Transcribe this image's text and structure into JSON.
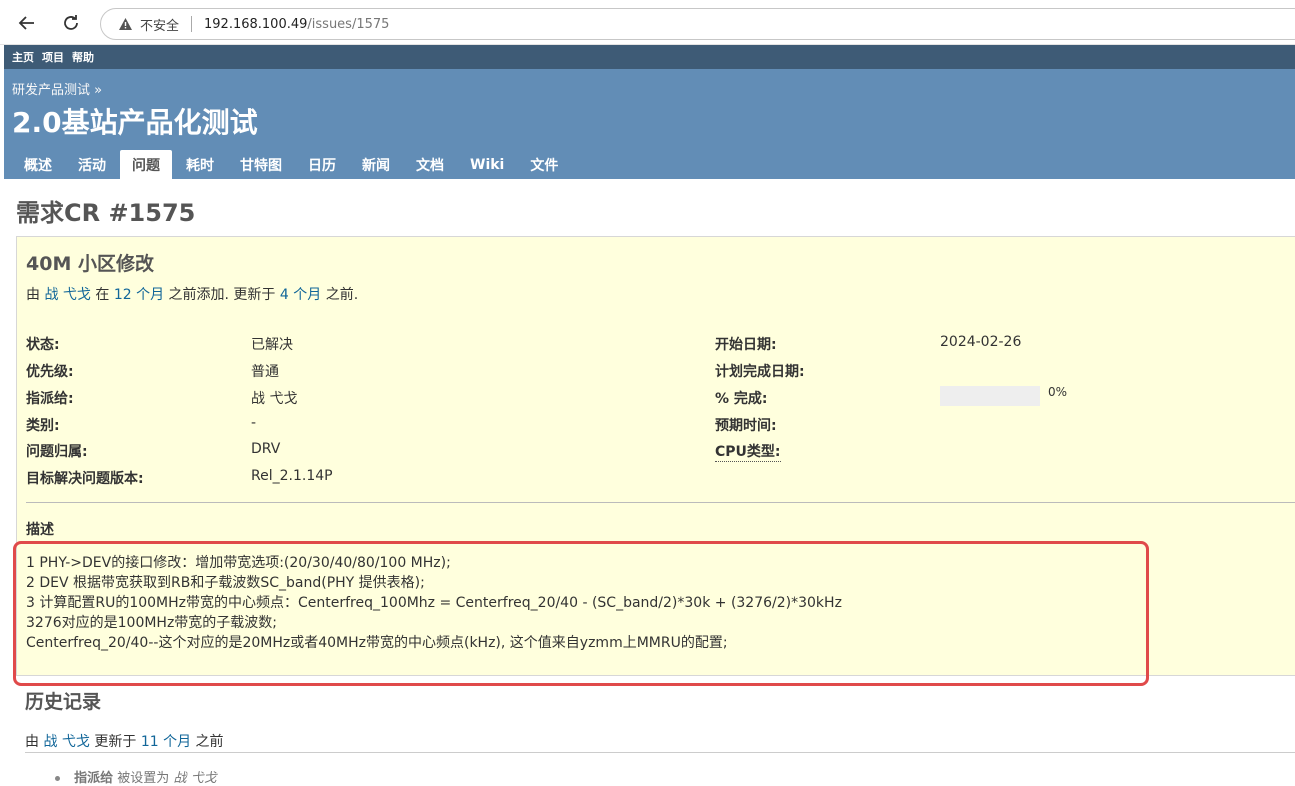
{
  "browser": {
    "insecure_label": "不安全",
    "url_host": "192.168.100.49",
    "url_path": "/issues/1575"
  },
  "top_menu": [
    "主页",
    "项目",
    "帮助"
  ],
  "header": {
    "parent_project": "研发产品测试 »",
    "project_title": "2.0基站产品化测试"
  },
  "tabs": [
    {
      "label": "概述",
      "selected": false
    },
    {
      "label": "活动",
      "selected": false
    },
    {
      "label": "问题",
      "selected": true
    },
    {
      "label": "耗时",
      "selected": false
    },
    {
      "label": "甘特图",
      "selected": false
    },
    {
      "label": "日历",
      "selected": false
    },
    {
      "label": "新闻",
      "selected": false
    },
    {
      "label": "文档",
      "selected": false
    },
    {
      "label": "Wiki",
      "selected": false
    },
    {
      "label": "文件",
      "selected": false
    }
  ],
  "issue": {
    "heading": "需求CR #1575",
    "subject": "40M 小区修改",
    "author_prefix": "由",
    "author": "战 弋戈",
    "added_prefix": "在",
    "added_ago": "12 个月",
    "added_suffix": "之前添加. 更新于",
    "updated_ago": "4 个月",
    "updated_suffix": "之前.",
    "attributes_left": [
      {
        "label": "状态:",
        "value": "已解决",
        "link": false
      },
      {
        "label": "优先级:",
        "value": "普通",
        "link": false
      },
      {
        "label": "指派给:",
        "value": "战 弋戈",
        "link": true
      },
      {
        "label": "类别:",
        "value": "-",
        "link": false
      },
      {
        "label": "问题归属:",
        "value": "DRV",
        "link": false
      },
      {
        "label": "目标解决问题版本:",
        "value": "Rel_2.1.14P",
        "link": false
      }
    ],
    "attributes_right": [
      {
        "label": "开始日期:",
        "value": "2024-02-26"
      },
      {
        "label": "计划完成日期:",
        "value": ""
      },
      {
        "label": "% 完成:",
        "value": ""
      },
      {
        "label": "预期时间:",
        "value": ""
      },
      {
        "label": "CPU类型:",
        "value": ""
      }
    ],
    "done_ratio": 0,
    "done_text": "0%",
    "description_label": "描述",
    "description_lines": [
      "1 PHY->DEV的接口修改：增加带宽选项:(20/30/40/80/100 MHz);",
      "2 DEV 根据带宽获取到RB和子载波数SC_band(PHY 提供表格);",
      "3 计算配置RU的100MHz带宽的中心频点：Centerfreq_100Mhz = Centerfreq_20/40 - (SC_band/2)*30k + (3276/2)*30kHz",
      "3276对应的是100MHz带宽的子载波数;",
      "Centerfreq_20/40--这个对应的是20MHz或者40MHz带宽的中心频点(kHz), 这个值来自yzmm上MMRU的配置;"
    ]
  },
  "history": {
    "heading": "历史记录",
    "author_prefix": "由",
    "author": "战 弋戈",
    "updated_prefix": "更新于",
    "updated_ago": "11 个月",
    "updated_suffix": "之前",
    "detail_field": "指派给",
    "detail_text": "被设置为",
    "detail_value": "战 弋戈"
  },
  "colors": {
    "top_menu_bg": "#3e5b76",
    "header_bg": "#628db6",
    "issue_bg": "#ffffdd",
    "link": "#116699",
    "highlight": "#e04a4a"
  }
}
